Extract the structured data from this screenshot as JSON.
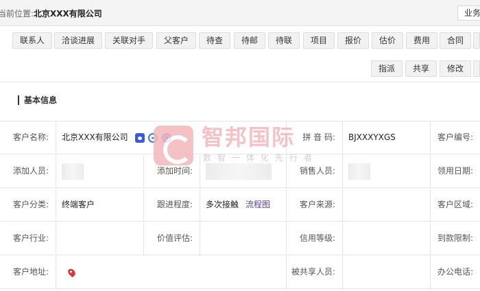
{
  "location": {
    "prefix": "当前位置:",
    "company": "北京XXX有限公司"
  },
  "top_right_button": "业务",
  "tabs_row1": [
    "联系人",
    "洽谈进展",
    "关联对手",
    "父客户",
    "待查",
    "待邮",
    "待联",
    "项目",
    "报价",
    "估价",
    "费用",
    "合同"
  ],
  "tabs_row2": [
    "指派",
    "共享",
    "修改"
  ],
  "section_title": "基本信息",
  "watermark": {
    "name": "智邦国际",
    "slogan": "数智一体化先行者"
  },
  "info": {
    "customer_name_label": "客户名称:",
    "customer_name": "北京XXX有限公司",
    "pinyin_label": "拼 音 码:",
    "pinyin": "BJXXXYXGS",
    "customer_no_label": "客户编号:",
    "added_by_label": "添加人员:",
    "added_time_label": "添加时间:",
    "sales_label": "销售人员:",
    "claim_date_label": "领用日期:",
    "category_label": "客户分类:",
    "category": "终端客户",
    "progress_label": "跟进程度:",
    "progress": "多次接触",
    "flowchart_link": "流程图",
    "source_label": "客户来源:",
    "region_label": "客户区域:",
    "industry_label": "客户行业:",
    "value_label": "价值评估:",
    "credit_label": "信用等级:",
    "payment_limit_label": "到款限制:",
    "address_label": "客户地址:",
    "shared_label": "被共享人员:",
    "office_phone_label": "办公电话:"
  },
  "icons": [
    "baidu-paw-icon",
    "ie-browser-icon",
    "search-engine-icon",
    "map-pin-icon",
    "watermark-logo-icon"
  ]
}
